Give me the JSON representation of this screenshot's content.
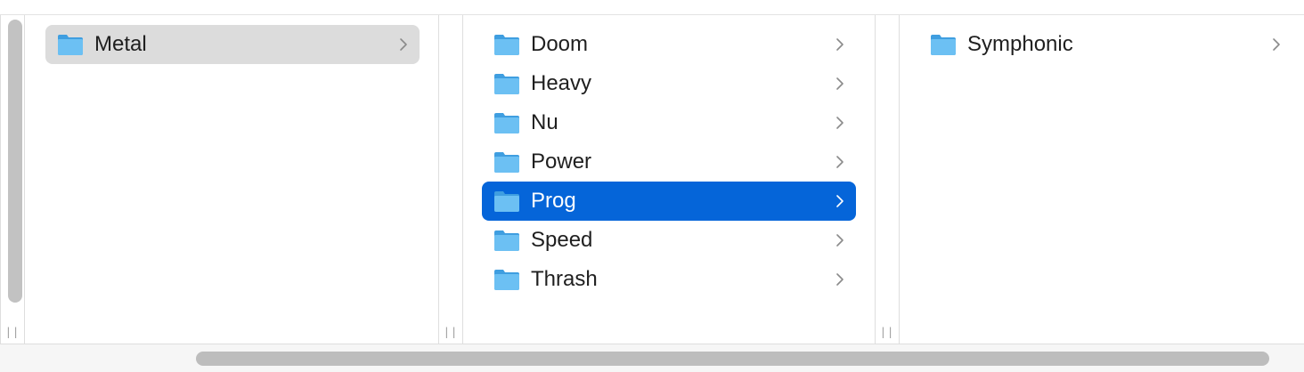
{
  "columns": [
    {
      "items": [
        {
          "label": "Metal",
          "icon": "folder-icon",
          "state": "path-selected"
        }
      ]
    },
    {
      "items": [
        {
          "label": "Doom",
          "icon": "folder-icon",
          "state": "normal"
        },
        {
          "label": "Heavy",
          "icon": "folder-icon",
          "state": "normal"
        },
        {
          "label": "Nu",
          "icon": "folder-icon",
          "state": "normal"
        },
        {
          "label": "Power",
          "icon": "folder-icon",
          "state": "normal"
        },
        {
          "label": "Prog",
          "icon": "folder-icon",
          "state": "active-selected"
        },
        {
          "label": "Speed",
          "icon": "folder-icon",
          "state": "normal"
        },
        {
          "label": "Thrash",
          "icon": "folder-icon",
          "state": "normal"
        }
      ]
    },
    {
      "items": [
        {
          "label": "Symphonic",
          "icon": "folder-icon",
          "state": "normal"
        }
      ]
    }
  ],
  "colors": {
    "selection_active": "#0565d9",
    "selection_path": "#dcdcdc",
    "folder_blue": "#58b4ee",
    "folder_tab": "#3f9ee0"
  },
  "icons": {
    "folder": "folder-icon",
    "chevron": "chevron-right-icon",
    "resize_handle": "column-resize-handle-icon"
  }
}
